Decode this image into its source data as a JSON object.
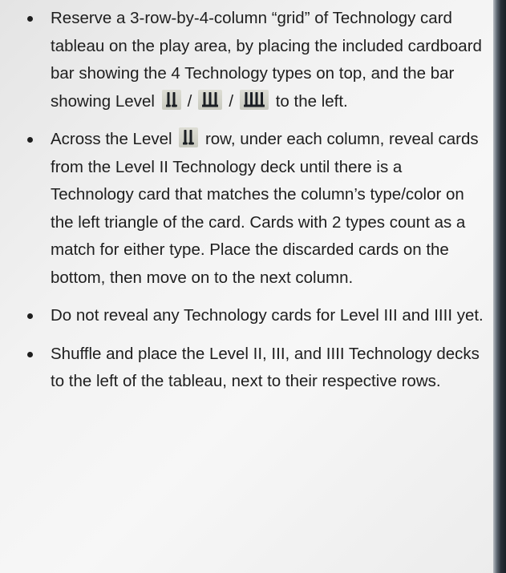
{
  "bullets": [
    {
      "text_1": "Reserve a 3-row-by-4-column “grid” of Technology card tableau on the play area, by placing the included cardboard bar showing the 4 Technology types on top, and the bar showing Level ",
      "slash_1": "/",
      "slash_2": "/",
      "text_2": " to the left."
    },
    {
      "text_1": "Across the Level ",
      "text_2": " row, under each column, reveal cards from the Level II Technology deck until there is a Technology card that matches the column’s type/color on the left triangle of the card. Cards with 2 types count as a match for either type. Place the discarded cards on the bottom, then move on to the next column."
    },
    {
      "text_1": "Do not reveal any Technology cards for Level III and IIII yet."
    },
    {
      "text_1": "Shuffle and place the Level II, III, and IIII Technology decks to the left of the tableau, next to their respective rows."
    }
  ],
  "icons": {
    "level_2": "level-ii-icon",
    "level_3": "level-iii-icon",
    "level_4": "level-iiii-icon"
  },
  "colors": {
    "text": "#1e1e1e",
    "badge_bg": "#d6d6cc",
    "badge_strokes": "#1b1f24",
    "edge_dark": "#1b2027"
  }
}
